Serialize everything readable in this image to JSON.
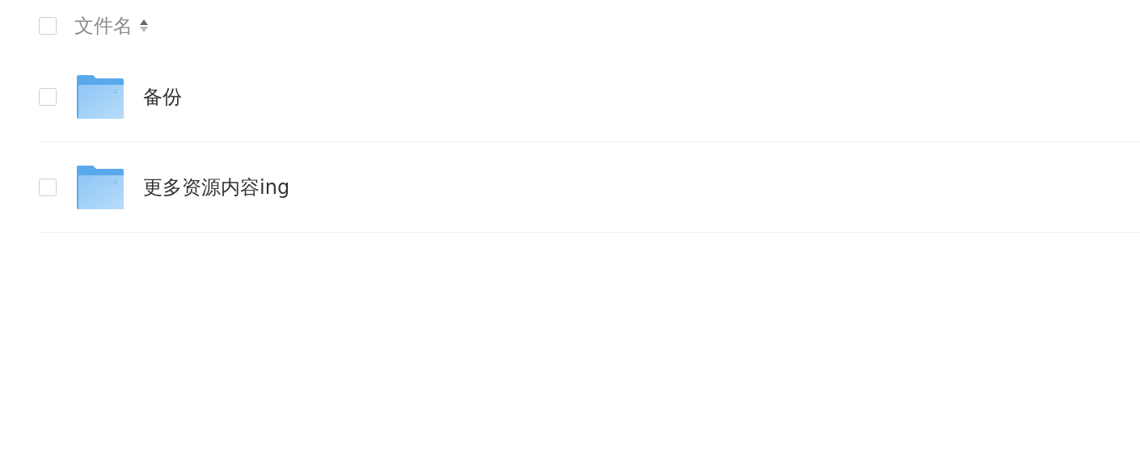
{
  "header": {
    "checked": false,
    "label": "文件名"
  },
  "files": [
    {
      "name": "备份",
      "checked": false
    },
    {
      "name": "更多资源内容ing",
      "checked": false
    }
  ]
}
